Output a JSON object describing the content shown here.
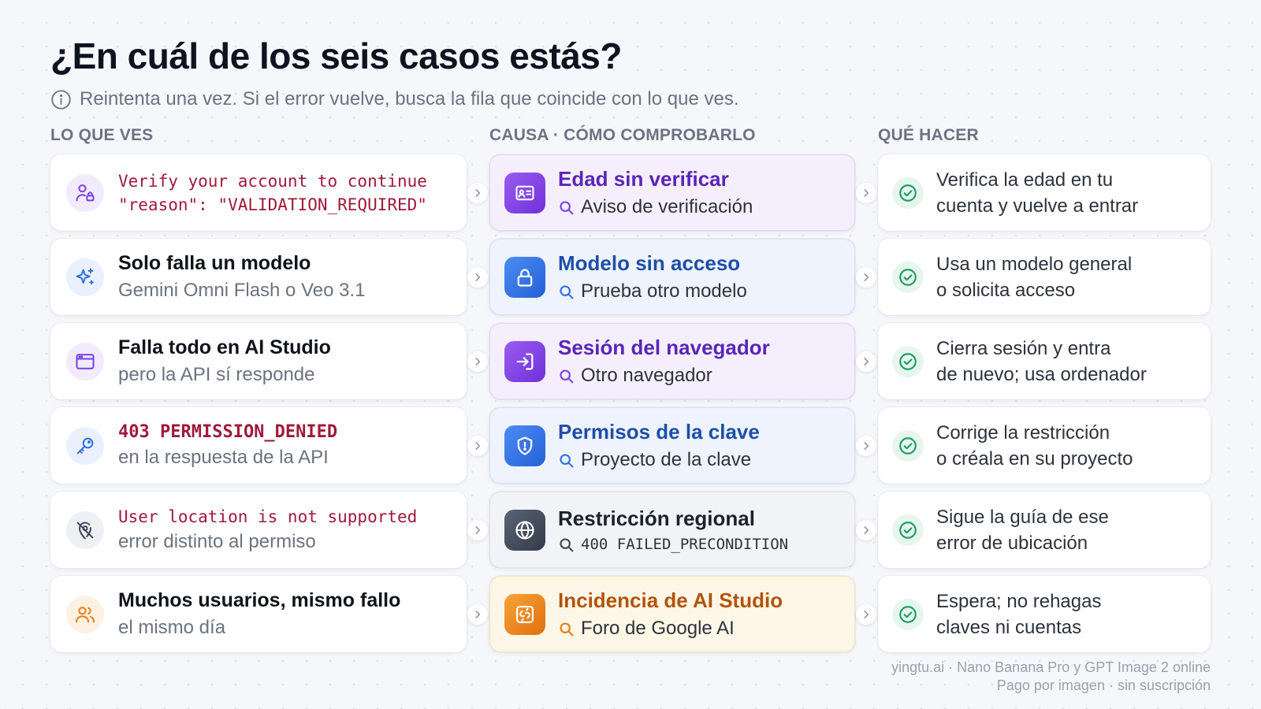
{
  "title": "¿En cuál de los seis casos estás?",
  "subtitle": "Reintenta una vez. Si el error vuelve, busca la fila que coincide con lo que ves.",
  "columns": [
    "LO QUE VES",
    "CAUSA · CÓMO COMPROBARLO",
    "QUÉ HACER"
  ],
  "rows": [
    {
      "see_line1": "Verify your account to continue",
      "see_line2": "\"reason\": \"VALIDATION_REQUIRED\"",
      "see_icon": "user-lock-icon",
      "cause_title": "Edad sin verificar",
      "cause_check": "Aviso de verificación",
      "cause_icon": "id-card-icon",
      "action_line1": "Verifica la edad en tu",
      "action_line2": "cuenta y vuelve a entrar"
    },
    {
      "see_line1": "Solo falla un modelo",
      "see_line2": "Gemini Omni Flash o Veo 3.1",
      "see_icon": "sparkles-icon",
      "cause_title": "Modelo sin acceso",
      "cause_check": "Prueba otro modelo",
      "cause_icon": "lock-icon",
      "action_line1": "Usa un modelo general",
      "action_line2": "o solicita acceso"
    },
    {
      "see_line1": "Falla todo en AI Studio",
      "see_line2": "pero la API sí responde",
      "see_icon": "browser-window-icon",
      "cause_title": "Sesión del navegador",
      "cause_check": "Otro navegador",
      "cause_icon": "sign-in-icon",
      "action_line1": "Cierra sesión y entra",
      "action_line2": "de nuevo; usa ordenador"
    },
    {
      "see_line1": "403 PERMISSION_DENIED",
      "see_line2": "en la respuesta de la API",
      "see_icon": "key-icon",
      "cause_title": "Permisos de la clave",
      "cause_check": "Proyecto de la clave",
      "cause_icon": "shield-alert-icon",
      "action_line1": "Corrige la restricción",
      "action_line2": "o créala en su proyecto"
    },
    {
      "see_line1": "User location is not supported",
      "see_line2": "error distinto al permiso",
      "see_icon": "location-off-icon",
      "cause_title": "Restricción regional",
      "cause_check": "400 FAILED_PRECONDITION",
      "cause_icon": "globe-icon",
      "action_line1": "Sigue la guía de ese",
      "action_line2": "error de ubicación"
    },
    {
      "see_line1": "Muchos usuarios, mismo fallo",
      "see_line2": "el mismo día",
      "see_icon": "users-icon",
      "cause_title": "Incidencia de AI Studio",
      "cause_check": "Foro de Google AI",
      "cause_icon": "broken-link-icon",
      "action_line1": "Espera; no rehagas",
      "action_line2": "claves ni cuentas"
    }
  ],
  "footer_line1": "yingtu.ai · Nano Banana Pro y GPT Image 2 online",
  "footer_line2": "Pago por imagen · sin suscripción",
  "colors": {
    "purple": "#7b3fe4",
    "blue": "#2f6fe0",
    "slate": "#3d4656",
    "orange": "#e57a12",
    "green": "#1f9d63",
    "code_red": "#9f1a3a"
  }
}
